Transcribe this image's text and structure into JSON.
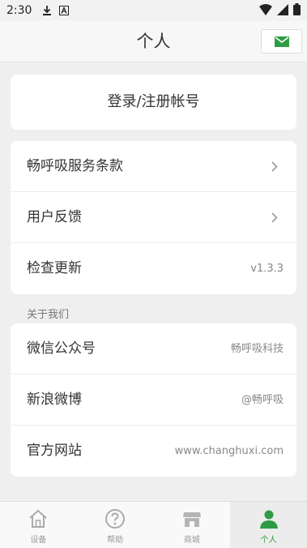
{
  "status_bar": {
    "time": "2:30"
  },
  "header": {
    "title": "个人"
  },
  "login": {
    "label": "登录/注册帐号"
  },
  "menu": [
    {
      "label": "畅呼吸服务条款"
    },
    {
      "label": "用户反馈"
    },
    {
      "label": "检查更新",
      "value": "v1.3.3"
    }
  ],
  "about": {
    "section_title": "关于我们",
    "items": [
      {
        "label": "微信公众号",
        "value": "畅呼吸科技"
      },
      {
        "label": "新浪微博",
        "value": "@畅呼吸"
      },
      {
        "label": "官方网站",
        "value": "www.changhuxi.com"
      }
    ]
  },
  "tabs": [
    {
      "label": "设备",
      "icon": "home-icon"
    },
    {
      "label": "帮助",
      "icon": "help-icon"
    },
    {
      "label": "商城",
      "icon": "store-icon"
    },
    {
      "label": "个人",
      "icon": "person-icon",
      "active": true
    }
  ],
  "colors": {
    "accent": "#2e9c44",
    "background": "#efefef"
  }
}
